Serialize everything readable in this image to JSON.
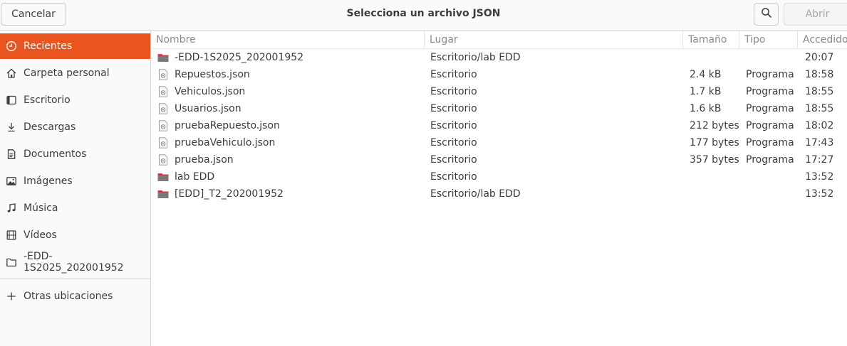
{
  "header": {
    "title": "Selecciona un archivo JSON",
    "cancel_label": "Cancelar",
    "open_label": "Abrir"
  },
  "sidebar": {
    "items": [
      {
        "label": "Recientes",
        "icon": "clock-icon"
      },
      {
        "label": "Carpeta personal",
        "icon": "home-icon"
      },
      {
        "label": "Escritorio",
        "icon": "desktop-icon"
      },
      {
        "label": "Descargas",
        "icon": "download-icon"
      },
      {
        "label": "Documentos",
        "icon": "document-icon"
      },
      {
        "label": "Imágenes",
        "icon": "image-icon"
      },
      {
        "label": "Música",
        "icon": "music-icon"
      },
      {
        "label": "Vídeos",
        "icon": "video-icon"
      },
      {
        "label": "-EDD-1S2025_202001952",
        "icon": "folder-icon"
      },
      {
        "label": "Otras ubicaciones",
        "icon": "plus-icon"
      }
    ]
  },
  "columns": [
    "Nombre",
    "Lugar",
    "Tamaño",
    "Tipo",
    "Accedido"
  ],
  "files": [
    {
      "name": "-EDD-1S2025_202001952",
      "location": "Escritorio/lab EDD",
      "size": "",
      "type": "",
      "accessed": "20:07",
      "kind": "folder"
    },
    {
      "name": "Repuestos.json",
      "location": "Escritorio",
      "size": "2.4 kB",
      "type": "Programa",
      "accessed": "18:58",
      "kind": "file"
    },
    {
      "name": "Vehiculos.json",
      "location": "Escritorio",
      "size": "1.7 kB",
      "type": "Programa",
      "accessed": "18:55",
      "kind": "file"
    },
    {
      "name": "Usuarios.json",
      "location": "Escritorio",
      "size": "1.6 kB",
      "type": "Programa",
      "accessed": "18:55",
      "kind": "file"
    },
    {
      "name": "pruebaRepuesto.json",
      "location": "Escritorio",
      "size": "212 bytes",
      "type": "Programa",
      "accessed": "18:02",
      "kind": "file"
    },
    {
      "name": "pruebaVehiculo.json",
      "location": "Escritorio",
      "size": "177 bytes",
      "type": "Programa",
      "accessed": "17:43",
      "kind": "file"
    },
    {
      "name": "prueba.json",
      "location": "Escritorio",
      "size": "357 bytes",
      "type": "Programa",
      "accessed": "17:27",
      "kind": "file"
    },
    {
      "name": "lab EDD",
      "location": "Escritorio",
      "size": "",
      "type": "",
      "accessed": "13:52",
      "kind": "folder"
    },
    {
      "name": "[EDD]_T2_202001952",
      "location": "Escritorio/lab EDD",
      "size": "",
      "type": "",
      "accessed": "13:52",
      "kind": "folder"
    }
  ],
  "colors": {
    "accent": "#e95420",
    "folder": "#6b6b6b",
    "folder_tab": "#c7404a"
  }
}
